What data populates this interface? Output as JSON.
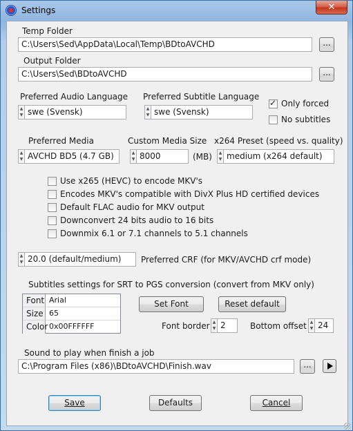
{
  "window": {
    "title": "Settings",
    "close_glyph": "✕"
  },
  "temp_folder": {
    "label": "Temp Folder",
    "value": "C:\\Users\\Sed\\AppData\\Local\\Temp\\BDtoAVCHD",
    "browse": "..."
  },
  "output_folder": {
    "label": "Output Folder",
    "value": "C:\\Users\\Sed\\BDtoAVCHD",
    "browse": "..."
  },
  "audio_language": {
    "label": "Preferred Audio Language",
    "value": "swe (Svensk)"
  },
  "subtitle_language": {
    "label": "Preferred Subtitle Language",
    "value": "swe (Svensk)"
  },
  "only_forced": {
    "label": "Only forced",
    "checked": true
  },
  "no_subtitles": {
    "label": "No subtitles",
    "checked": false
  },
  "media": {
    "label": "Preferred Media",
    "value": "AVCHD BD5 (4.7 GB)"
  },
  "custom_media": {
    "label": "Custom Media Size",
    "value": "8000",
    "unit": "(MB)"
  },
  "x264_preset": {
    "label": "x264 Preset (speed vs. quality)",
    "value": "medium (x264 default)"
  },
  "options": [
    {
      "label": "Use x265 (HEVC) to encode MKV's",
      "checked": false
    },
    {
      "label": "Encodes MKV's compatible with DivX Plus HD certified devices",
      "checked": false
    },
    {
      "label": "Default FLAC audio for MKV output",
      "checked": false
    },
    {
      "label": "Downconvert 24 bits audio to 16 bits",
      "checked": false
    },
    {
      "label": "Downmix 6.1 or 7.1 channels to 5.1 channels",
      "checked": false
    }
  ],
  "crf": {
    "value": "20.0 (default/medium)",
    "label": "Preferred CRF (for MKV/AVCHD crf mode)"
  },
  "subtitles": {
    "heading": "Subtitles settings for SRT to PGS conversion (convert from MKV only)",
    "rows": [
      {
        "key": "Font",
        "value": "Arial"
      },
      {
        "key": "Size",
        "value": "65"
      },
      {
        "key": "Color",
        "value": "0x00FFFFFF"
      }
    ],
    "set_font": "Set Font",
    "reset_default": "Reset default",
    "font_border_label": "Font border",
    "font_border_value": "2",
    "bottom_offset_label": "Bottom offset",
    "bottom_offset_value": "24"
  },
  "sound": {
    "label": "Sound to play when finish a job",
    "value": "C:\\Program Files (x86)\\BDtoAVCHD\\Finish.wav",
    "browse": "..."
  },
  "buttons": {
    "save": "Save",
    "defaults": "Defaults",
    "cancel": "Cancel"
  }
}
